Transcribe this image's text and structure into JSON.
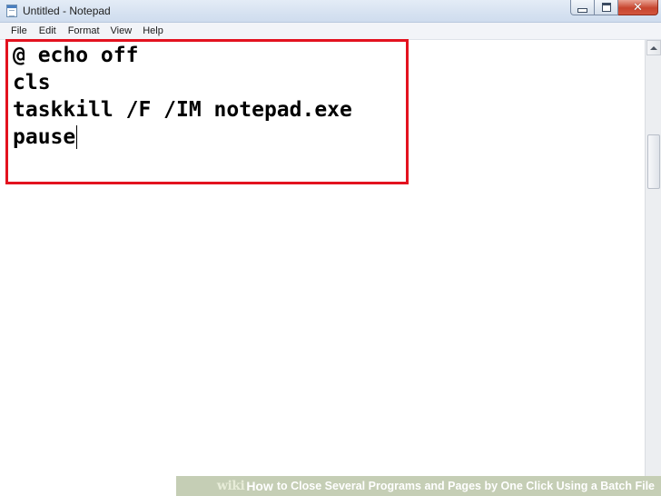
{
  "window": {
    "title": "Untitled - Notepad",
    "controls": {
      "minimize_icon": "minimize-icon",
      "maximize_icon": "maximize-icon",
      "close_icon": "close-icon",
      "close_glyph": "✕"
    }
  },
  "menubar": {
    "items": [
      "File",
      "Edit",
      "Format",
      "View",
      "Help"
    ]
  },
  "editor": {
    "lines": [
      "@ echo off",
      "cls",
      "taskkill /F /IM notepad.exe",
      "pause"
    ],
    "highlight_color": "#e3121f"
  },
  "caption": {
    "logo": "wiki",
    "how": "How",
    "rest": "to Close Several Programs and Pages by One Click Using a Batch File"
  }
}
